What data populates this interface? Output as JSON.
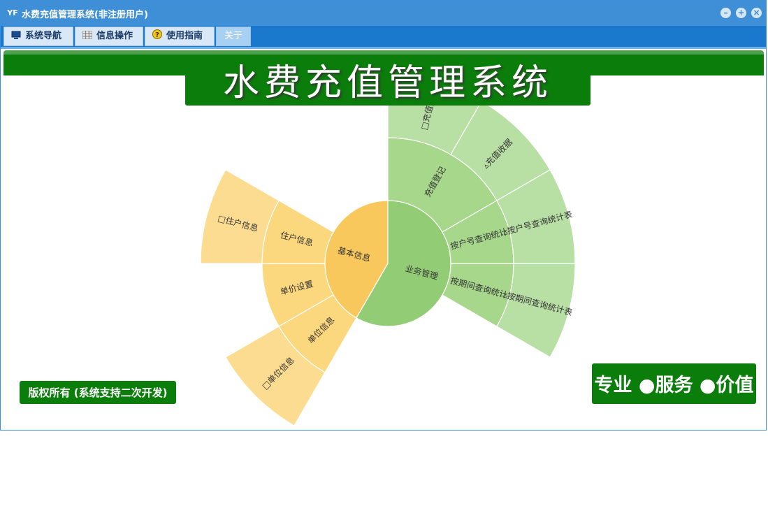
{
  "window": {
    "title": "水费充值管理系统(非注册用户)",
    "app_icon": "YF"
  },
  "menu": {
    "tabs": [
      {
        "label": "系统导航",
        "icon": "monitor-icon"
      },
      {
        "label": "信息操作",
        "icon": "grid-icon"
      },
      {
        "label": "使用指南",
        "icon": "help-icon"
      },
      {
        "label": "关于",
        "icon": ""
      }
    ]
  },
  "banner": {
    "title": "水费充值管理系统"
  },
  "footer": {
    "copyright": "版权所有 (系统支持二次开发)",
    "slogan": "专业 ●服务 ●价值"
  },
  "sunburst": {
    "colors": {
      "orange_center": "#f9c85c",
      "orange_ring": "#fbd77d",
      "orange_outer": "#fcdc90",
      "green_center": "#92cc74",
      "green_ring": "#a6d78b",
      "green_outer": "#b8e0a4"
    },
    "center": [
      {
        "label": "基本信息"
      },
      {
        "label": "业务管理"
      }
    ],
    "ring": [
      {
        "label": "住户信息"
      },
      {
        "label": "单价设置"
      },
      {
        "label": "单位信息"
      },
      {
        "label": "充值登记"
      },
      {
        "label": "按户号查询统计"
      },
      {
        "label": "按期间查询统计"
      }
    ],
    "outer": [
      {
        "label": "□住户信息"
      },
      {
        "label": "□单位信息"
      },
      {
        "label": "□充值登"
      },
      {
        "label": "▵充值收据"
      },
      {
        "label": "▵按户号查询统计表"
      },
      {
        "label": "▵按期间查询统计表"
      }
    ]
  }
}
